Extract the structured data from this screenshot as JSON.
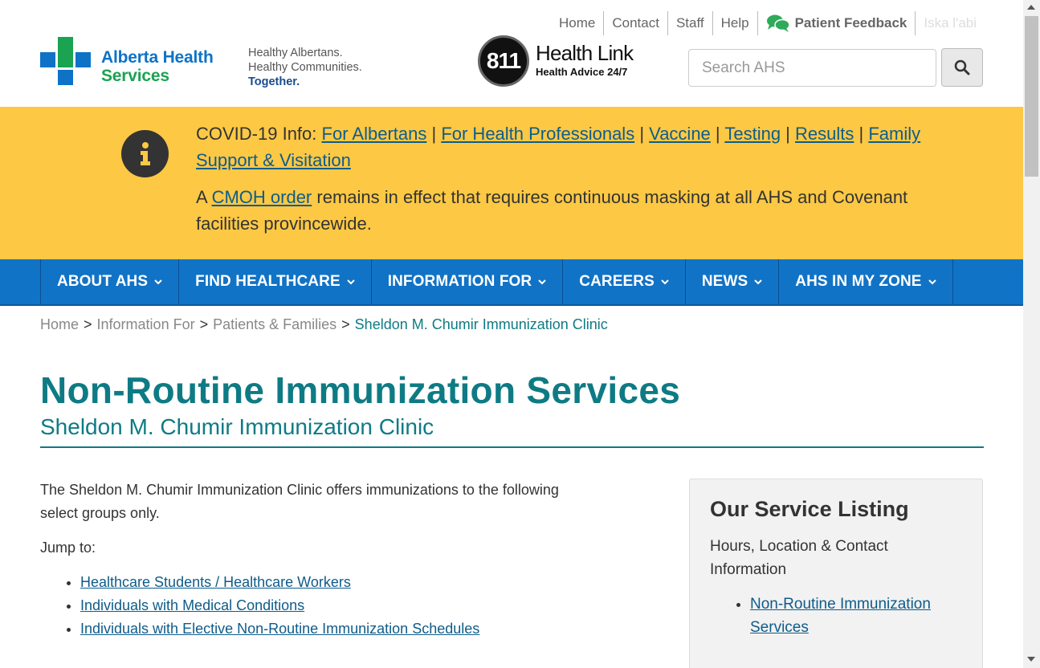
{
  "header": {
    "logo_line1": "Alberta Health",
    "logo_line2": "Services",
    "tagline_line1": "Healthy Albertans.",
    "tagline_line2": "Healthy Communities.",
    "tagline_line3": "Together.",
    "healthlink_number": "811",
    "healthlink_title": "Health Link",
    "healthlink_sub": "Health Advice 24/7",
    "top_links": [
      "Home",
      "Contact",
      "Staff",
      "Help"
    ],
    "feedback_label": "Patient Feedback",
    "language_label": "Iska l'abi",
    "search_placeholder": "Search AHS"
  },
  "alert": {
    "prefix": "COVID-19 Info: ",
    "links": [
      "For Albertans",
      "For Health Professionals",
      "Vaccine",
      "Testing",
      "Results",
      "Family Support & Visitation"
    ],
    "separator": " | ",
    "masking_prefix": "A ",
    "masking_link": "CMOH order",
    "masking_suffix": " remains in effect that requires continuous masking at all AHS and Covenant facilities provincewide."
  },
  "mainnav": [
    "ABOUT AHS",
    "FIND HEALTHCARE",
    "INFORMATION FOR",
    "CAREERS",
    "NEWS",
    "AHS IN MY ZONE"
  ],
  "breadcrumb": {
    "items": [
      "Home",
      "Information For",
      "Patients & Families"
    ],
    "separator": ">",
    "current": "Sheldon M. Chumir Immunization Clinic"
  },
  "page": {
    "title": "Non-Routine Immunization Services",
    "subtitle": "Sheldon M. Chumir Immunization Clinic",
    "intro": "The Sheldon M. Chumir Immunization Clinic offers immunizations to the following select groups only.",
    "jump_label": "Jump to:",
    "jump_links": [
      "Healthcare Students / Healthcare Workers",
      "Individuals with Medical Conditions",
      "Individuals with Elective Non-Routine Immunization Schedules"
    ]
  },
  "sidebar": {
    "heading": "Our Service Listing",
    "text": "Hours, Location & Contact Information",
    "links": [
      "Non-Routine Immunization Services"
    ]
  },
  "colors": {
    "teal": "#0e7b84",
    "nav_blue": "#1173c6",
    "alert_yellow": "#fdc844",
    "link": "#0e5c8a",
    "logo_blue": "#0e72c7",
    "logo_green": "#1aa351"
  }
}
